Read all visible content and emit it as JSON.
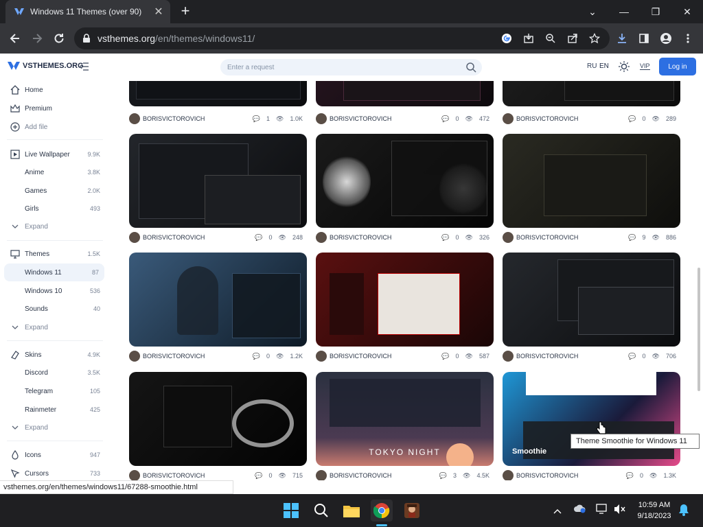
{
  "browser": {
    "tab_title": "Windows 11 Themes (over 90)",
    "url_host": "vsthemes.org",
    "url_path": "/en/themes/windows11/",
    "status_url": "vsthemes.org/en/themes/windows11/67288-smoothie.html"
  },
  "site": {
    "logo_text": "VSTHEMES.ORG",
    "search_placeholder": "Enter a request",
    "lang_ru": "RU",
    "lang_en": "EN",
    "vip": "VIP",
    "login": "Log in"
  },
  "sidebar": [
    {
      "label": "Home",
      "count": "",
      "icon": "home-icon"
    },
    {
      "label": "Premium",
      "count": "",
      "icon": "crown-icon"
    },
    {
      "label": "Add file",
      "count": "",
      "icon": "add-icon"
    },
    {
      "label": "Live Wallpaper",
      "count": "9.9K",
      "icon": "play-icon"
    },
    {
      "label": "Anime",
      "count": "3.8K"
    },
    {
      "label": "Games",
      "count": "2.0K"
    },
    {
      "label": "Girls",
      "count": "493"
    },
    {
      "label": "Expand",
      "count": ""
    },
    {
      "label": "Themes",
      "count": "1.5K",
      "icon": "monitor-icon"
    },
    {
      "label": "Windows 11",
      "count": "87"
    },
    {
      "label": "Windows 10",
      "count": "536"
    },
    {
      "label": "Sounds",
      "count": "40"
    },
    {
      "label": "Expand",
      "count": ""
    },
    {
      "label": "Skins",
      "count": "4.9K",
      "icon": "skins-icon"
    },
    {
      "label": "Discord",
      "count": "3.5K"
    },
    {
      "label": "Telegram",
      "count": "105"
    },
    {
      "label": "Rainmeter",
      "count": "425"
    },
    {
      "label": "Expand",
      "count": ""
    },
    {
      "label": "Icons",
      "count": "947",
      "icon": "drop-icon"
    },
    {
      "label": "Cursors",
      "count": "733",
      "icon": "cursor-icon"
    }
  ],
  "cards": [
    {
      "author": "BORISVICTOROVICH",
      "comments": "1",
      "views": "1.0K"
    },
    {
      "author": "BORISVICTOROVICH",
      "comments": "0",
      "views": "472"
    },
    {
      "author": "BORISVICTOROVICH",
      "comments": "0",
      "views": "289"
    },
    {
      "author": "BORISVICTOROVICH",
      "comments": "0",
      "views": "248"
    },
    {
      "author": "BORISVICTOROVICH",
      "comments": "0",
      "views": "326"
    },
    {
      "author": "BORISVICTOROVICH",
      "comments": "9",
      "views": "886"
    },
    {
      "author": "BORISVICTOROVICH",
      "comments": "0",
      "views": "1.2K"
    },
    {
      "author": "BORISVICTOROVICH",
      "comments": "0",
      "views": "587"
    },
    {
      "author": "BORISVICTOROVICH",
      "comments": "0",
      "views": "706"
    },
    {
      "author": "BORISVICTOROVICH",
      "comments": "0",
      "views": "715"
    },
    {
      "author": "BORISVICTOROVICH",
      "comments": "3",
      "views": "4.5K",
      "image_text": "TOKYO NIGHT"
    },
    {
      "author": "BORISVICTOROVICH",
      "comments": "0",
      "views": "1.3K",
      "image_text": "Smoothie"
    }
  ],
  "tooltip": "Theme Smoothie for Windows 11",
  "clock": {
    "time": "10:59 AM",
    "date": "9/18/2023"
  },
  "colors": {
    "accent": "#2d6fe2",
    "chrome_dark": "#202124",
    "chrome_toolbar": "#35363a"
  }
}
